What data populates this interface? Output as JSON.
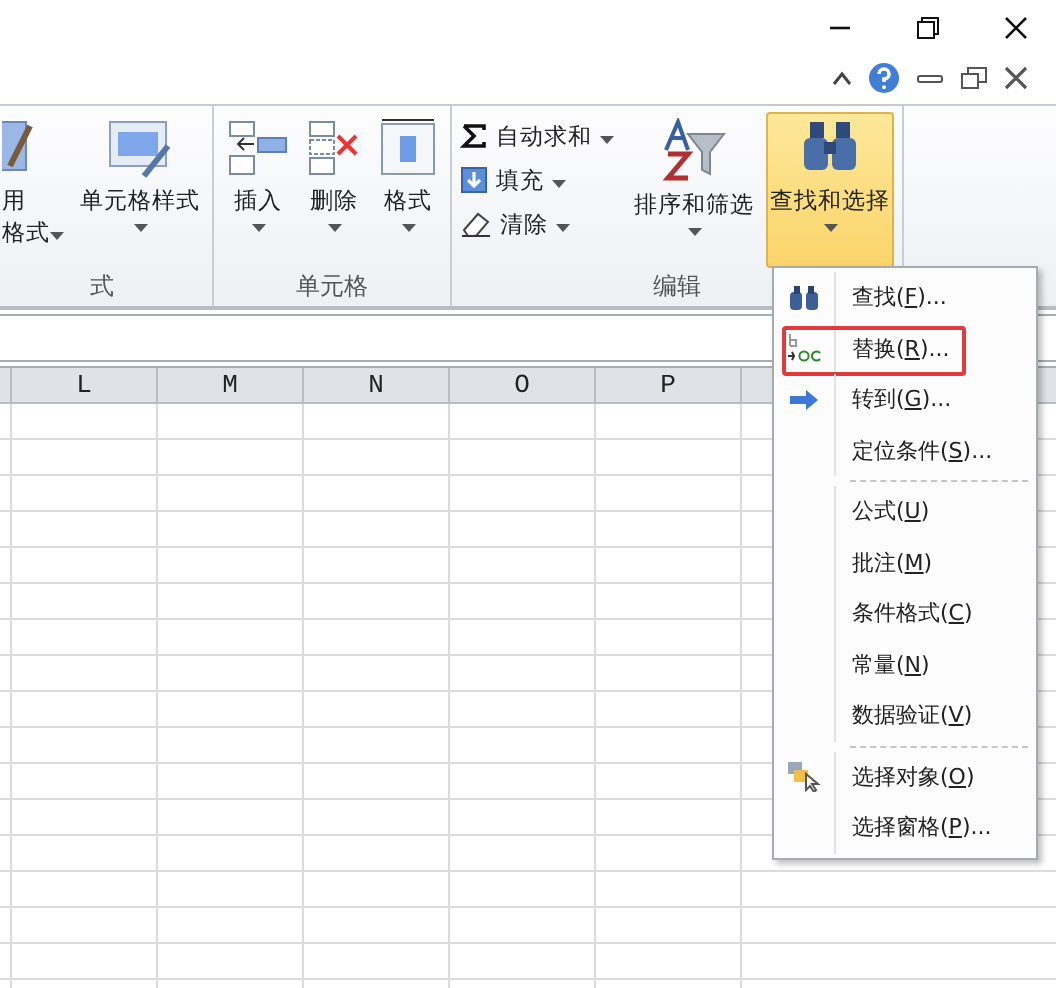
{
  "ribbon": {
    "groups": [
      {
        "label": "式",
        "buttons": [
          {
            "kind": "large",
            "lines": [
              "用",
              "格式"
            ],
            "dropdown": true
          },
          {
            "kind": "large",
            "lines": [
              "单元格样式"
            ],
            "dropdown": true
          }
        ]
      },
      {
        "label": "单元格",
        "buttons": [
          {
            "kind": "large",
            "lines": [
              "插入"
            ],
            "dropdown": true
          },
          {
            "kind": "large",
            "lines": [
              "删除"
            ],
            "dropdown": true
          },
          {
            "kind": "large",
            "lines": [
              "格式"
            ],
            "dropdown": true
          }
        ]
      },
      {
        "label": "编辑",
        "buttons": [
          {
            "kind": "stack",
            "items": [
              {
                "label": "自动求和",
                "dropdown": true
              },
              {
                "label": "填充",
                "dropdown": true
              },
              {
                "label": "清除",
                "dropdown": true
              }
            ]
          },
          {
            "kind": "large",
            "lines": [
              "排序和筛选"
            ],
            "dropdown": true,
            "open": false
          },
          {
            "kind": "large",
            "lines": [
              "查找和选择"
            ],
            "dropdown": true,
            "open": true
          }
        ]
      }
    ]
  },
  "columns": [
    "L",
    "M",
    "N",
    "O",
    "P"
  ],
  "menu": [
    {
      "kind": "item",
      "before": "查找(",
      "key": "F",
      "after": ")...",
      "annotated": false
    },
    {
      "kind": "item",
      "before": "替换(",
      "key": "R",
      "after": ")...",
      "annotated": true
    },
    {
      "kind": "item",
      "before": "转到(",
      "key": "G",
      "after": ")...",
      "annotated": false
    },
    {
      "kind": "item",
      "before": "定位条件(",
      "key": "S",
      "after": ")...",
      "annotated": false
    },
    {
      "kind": "separator"
    },
    {
      "kind": "item",
      "before": "公式(",
      "key": "U",
      "after": ")",
      "annotated": false
    },
    {
      "kind": "item",
      "before": "批注(",
      "key": "M",
      "after": ")",
      "annotated": false
    },
    {
      "kind": "item",
      "before": "条件格式(",
      "key": "C",
      "after": ")",
      "annotated": false
    },
    {
      "kind": "item",
      "before": "常量(",
      "key": "N",
      "after": ")",
      "annotated": false
    },
    {
      "kind": "item",
      "before": "数据验证(",
      "key": "V",
      "after": ")",
      "annotated": false
    },
    {
      "kind": "separator"
    },
    {
      "kind": "item",
      "before": "选择对象(",
      "key": "O",
      "after": ")",
      "annotated": false
    },
    {
      "kind": "item",
      "before": "选择窗格(",
      "key": "P",
      "after": ")...",
      "annotated": false
    }
  ]
}
